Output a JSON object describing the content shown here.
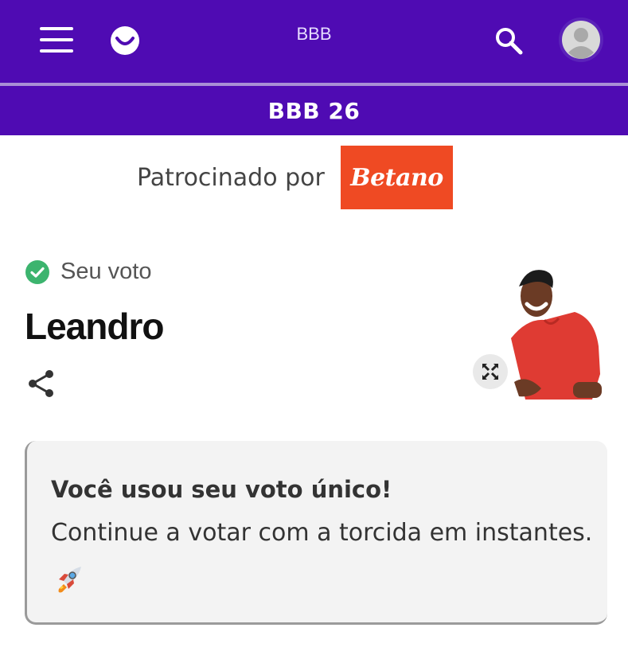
{
  "header": {
    "title": "BBB",
    "section_title": "BBB 26",
    "icons": [
      "menu-icon",
      "logo-icon",
      "search-icon",
      "user-avatar-icon"
    ],
    "brand_color": "#4f0bb3"
  },
  "sponsor": {
    "label": "Patrocinado por",
    "brand": "Betano",
    "brand_color": "#ef4a23"
  },
  "vote": {
    "status_label": "Seu voto",
    "candidate_name": "Leandro",
    "status_color": "#3cb46e"
  },
  "notice": {
    "title": "Você usou seu voto único!",
    "message": "Continue a votar com a torcida em instantes.",
    "emoji_icon": "rocket-icon"
  }
}
